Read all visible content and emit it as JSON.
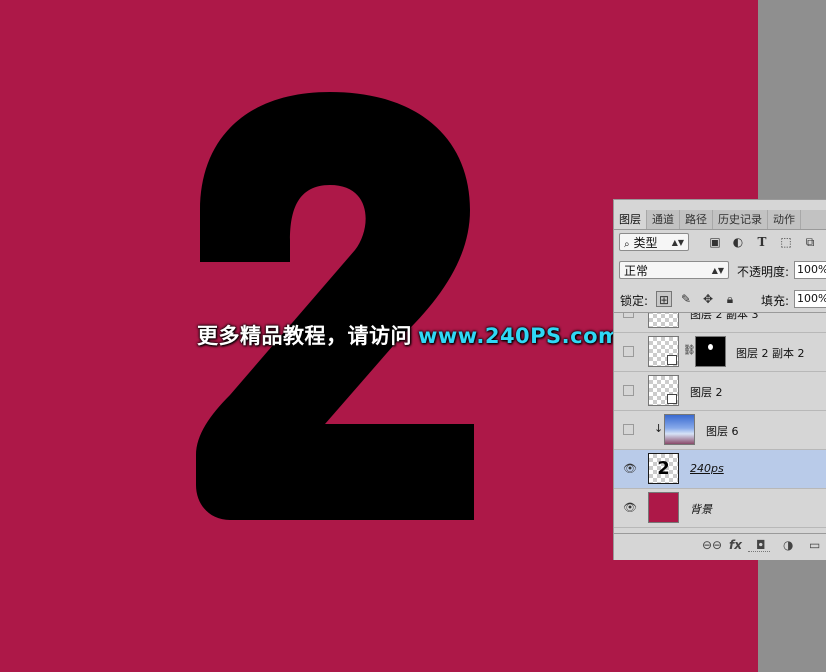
{
  "watermark": {
    "text_cn": "更多精品教程，请访问",
    "url": "www.240PS.com"
  },
  "canvas_digit": "2",
  "layers_panel": {
    "tabs": [
      "图层",
      "通道",
      "路径",
      "历史记录",
      "动作"
    ],
    "filter": {
      "value": "类型"
    },
    "filter_icons": [
      "image-filter-icon",
      "adjustment-filter-icon",
      "type-filter-icon",
      "shape-filter-icon",
      "smart-object-filter-icon"
    ],
    "blend_mode": "正常",
    "opacity_label": "不透明度:",
    "opacity_value": "100%",
    "lock_label": "锁定:",
    "fill_label": "填充:",
    "fill_value": "100%",
    "layers": [
      {
        "name": "图层 2 副本 3",
        "visible": false
      },
      {
        "name": "图层 2 副本 2",
        "visible": false,
        "has_mask": true
      },
      {
        "name": "图层 2",
        "visible": false
      },
      {
        "name": "图层 6",
        "visible": false,
        "clipped": true
      },
      {
        "name": "240ps",
        "visible": true,
        "selected": true,
        "thumb_text": "2"
      },
      {
        "name": "背景",
        "visible": true
      }
    ],
    "bottom_icons": [
      "link-icon",
      "fx-icon",
      "add-mask-icon",
      "adjustment-icon",
      "group-folder-icon"
    ],
    "fx_label": "fx"
  },
  "colors": {
    "canvas": "#ad1848",
    "selected_layer": "#b9cbe9",
    "url": "#2fd8f5"
  }
}
